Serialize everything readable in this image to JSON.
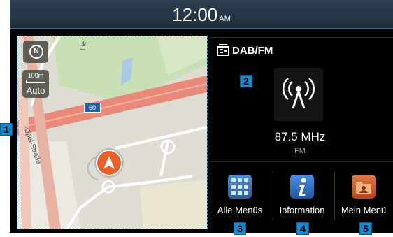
{
  "status_bar": {
    "time": "12:00",
    "ampm": "AM"
  },
  "map": {
    "compass_label": "N",
    "scale_distance": "100m",
    "zoom_mode": "Auto",
    "street_labels": [
      "Lie",
      "-Opel-Straße"
    ],
    "road_shield": "60"
  },
  "radio": {
    "source_label": "DAB/FM",
    "frequency": "87.5 MHz",
    "band": "FM",
    "icon": "radio-antenna-icon"
  },
  "menu": [
    {
      "label": "Alle Menüs",
      "icon": "grid-icon",
      "color": "#3a73b8"
    },
    {
      "label": "Information",
      "icon": "info-icon",
      "color": "#2c6fc0"
    },
    {
      "label": "Mein Menü",
      "icon": "folder-icon",
      "color": "#c2552a"
    }
  ],
  "callouts": [
    "1",
    "2",
    "3",
    "4",
    "5"
  ],
  "colors": {
    "callout": "#1789d0",
    "status_bar": "#2c3f50",
    "map_border": "#1aa0d6"
  }
}
